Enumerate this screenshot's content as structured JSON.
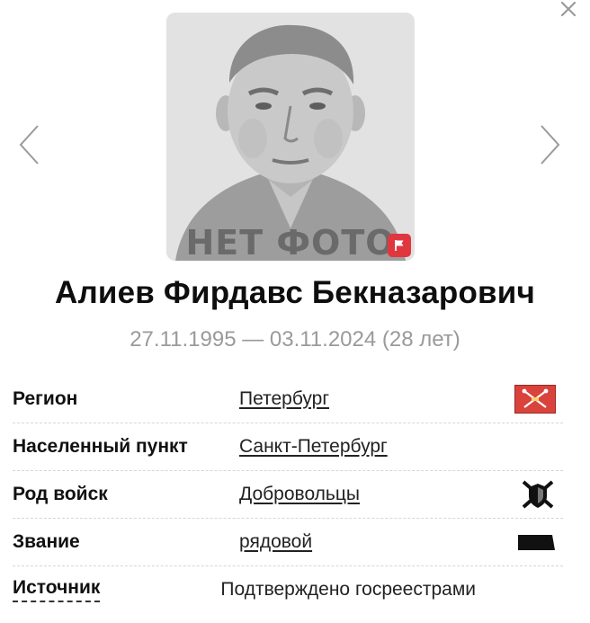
{
  "photo": {
    "placeholder_text": "НЕТ ФОТО",
    "report_color": "#e0373f"
  },
  "person": {
    "name": "Алиев Фирдавс Бекназарович",
    "lifespan": "27.11.1995 — 03.11.2024 (28 лет)"
  },
  "details": [
    {
      "label": "Регион",
      "value": "Петербург",
      "icon": "region-flag-icon"
    },
    {
      "label": "Населенный пункт",
      "value": "Санкт-Петербург"
    },
    {
      "label": "Род войск",
      "value": "Добровольцы",
      "icon": "volunteers-emblem-icon"
    },
    {
      "label": "Звание",
      "value": "рядовой",
      "icon": "rank-insignia-icon"
    },
    {
      "label": "Источник",
      "value": "Подтверждено госреестрами"
    }
  ],
  "icons": {
    "close": "close-icon",
    "prev": "chevron-left-icon",
    "next": "chevron-right-icon",
    "report": "flag-icon"
  },
  "colors": {
    "region_flag": "#d9433b",
    "muted_text": "#9a9a9a"
  }
}
